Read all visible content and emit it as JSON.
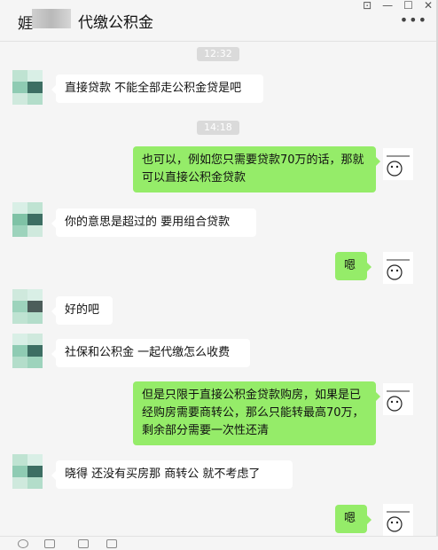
{
  "header": {
    "title": "代缴公积金",
    "more_glyph": "•••"
  },
  "window": {
    "pin": "⊡",
    "minimize": "—",
    "maximize": "☐",
    "close": "✕"
  },
  "messages": {
    "t1": "12:32",
    "m1": "直接贷款 不能全部走公积金贷是吧",
    "t2": "14:18",
    "m2": "也可以，例如您只需要贷款70万的话，那就可以直接公积金贷款",
    "m3": "你的意思是超过的  要用组合贷款",
    "m4": "嗯",
    "m5": "好的吧",
    "m6": "社保和公积金 一起代缴怎么收费",
    "m7": "但是只限于直接公积金贷款购房，如果是已经购房需要商转公，那么只能转最高70万，剩余部分需要一次性还清",
    "m8": "晓得  还没有买房那   商转公 就不考虑了",
    "m9": "嗯"
  },
  "icons": [
    "emoji-icon",
    "folder-icon",
    "scissors-icon",
    "chat-history-icon"
  ],
  "colors": {
    "outgoing": "#95ec69",
    "incoming": "#ffffff",
    "background": "#f5f5f5"
  }
}
